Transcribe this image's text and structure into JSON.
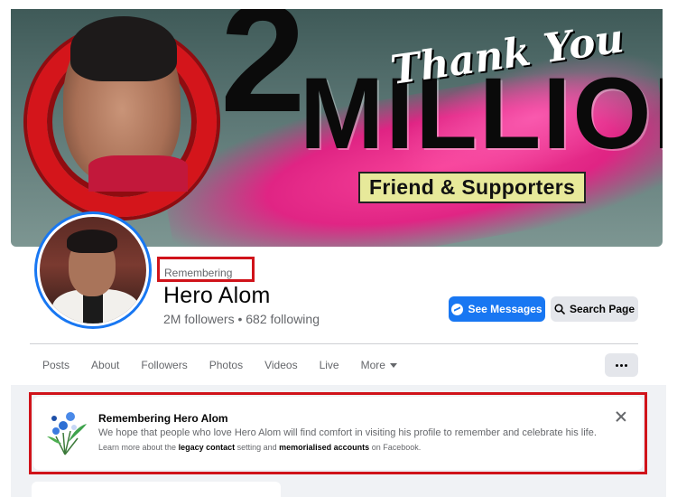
{
  "cover": {
    "number": "2",
    "thank_you": "Thank You",
    "million": "MILLION",
    "tagline": "Friend & Supporters"
  },
  "profile": {
    "status": "Remembering",
    "name": "Hero Alom",
    "followers": "2M followers • 682 following"
  },
  "actions": {
    "messages_label": "See Messages",
    "search_label": "Search Page",
    "messages_icon": "messenger-icon",
    "search_icon": "search-icon"
  },
  "tabs": [
    "Posts",
    "About",
    "Followers",
    "Photos",
    "Videos",
    "Live",
    "More"
  ],
  "notice": {
    "title": "Remembering Hero Alom",
    "body": "We hope that people who love Hero Alom will find comfort in visiting his profile to remember and celebrate his life.",
    "learn_prefix": "Learn more about the ",
    "legacy_link": "legacy contact",
    "learn_middle": " setting and ",
    "memorialised_link": "memorialised accounts",
    "learn_suffix": " on Facebook.",
    "icon": "flower-bouquet-icon"
  },
  "colors": {
    "accent": "#1877f2",
    "highlight_outline": "#d0131a",
    "muted_text": "#65676b",
    "page_bg": "#f0f2f5"
  }
}
